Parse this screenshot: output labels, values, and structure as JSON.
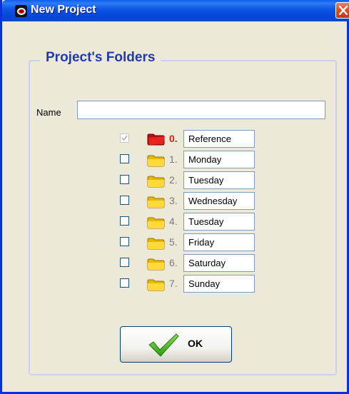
{
  "window": {
    "title": "New Project",
    "title_bar_color": "#0A5EEB",
    "close_icon": "close-icon"
  },
  "group": {
    "title": "Project's Folders"
  },
  "name_field": {
    "label": "Name",
    "value": ""
  },
  "folders": [
    {
      "number": "0.",
      "name": "Reference",
      "checked": true,
      "disabled": true,
      "icon": "red-flag-folder-icon",
      "color": "#E0191A"
    },
    {
      "number": "1.",
      "name": "Monday",
      "checked": false,
      "disabled": false,
      "icon": "yellow-folder-icon"
    },
    {
      "number": "2.",
      "name": "Tuesday",
      "checked": false,
      "disabled": false,
      "icon": "yellow-folder-icon"
    },
    {
      "number": "3.",
      "name": "Wednesday",
      "checked": false,
      "disabled": false,
      "icon": "yellow-folder-icon"
    },
    {
      "number": "4.",
      "name": "Tuesday",
      "checked": false,
      "disabled": false,
      "icon": "yellow-folder-icon"
    },
    {
      "number": "5.",
      "name": "Friday",
      "checked": false,
      "disabled": false,
      "icon": "yellow-folder-icon"
    },
    {
      "number": "6.",
      "name": "Saturday",
      "checked": false,
      "disabled": false,
      "icon": "yellow-folder-icon"
    },
    {
      "number": "7.",
      "name": "Sunday",
      "checked": false,
      "disabled": false,
      "icon": "yellow-folder-icon"
    }
  ],
  "ok_button": {
    "label": "OK",
    "icon": "green-check-icon"
  }
}
